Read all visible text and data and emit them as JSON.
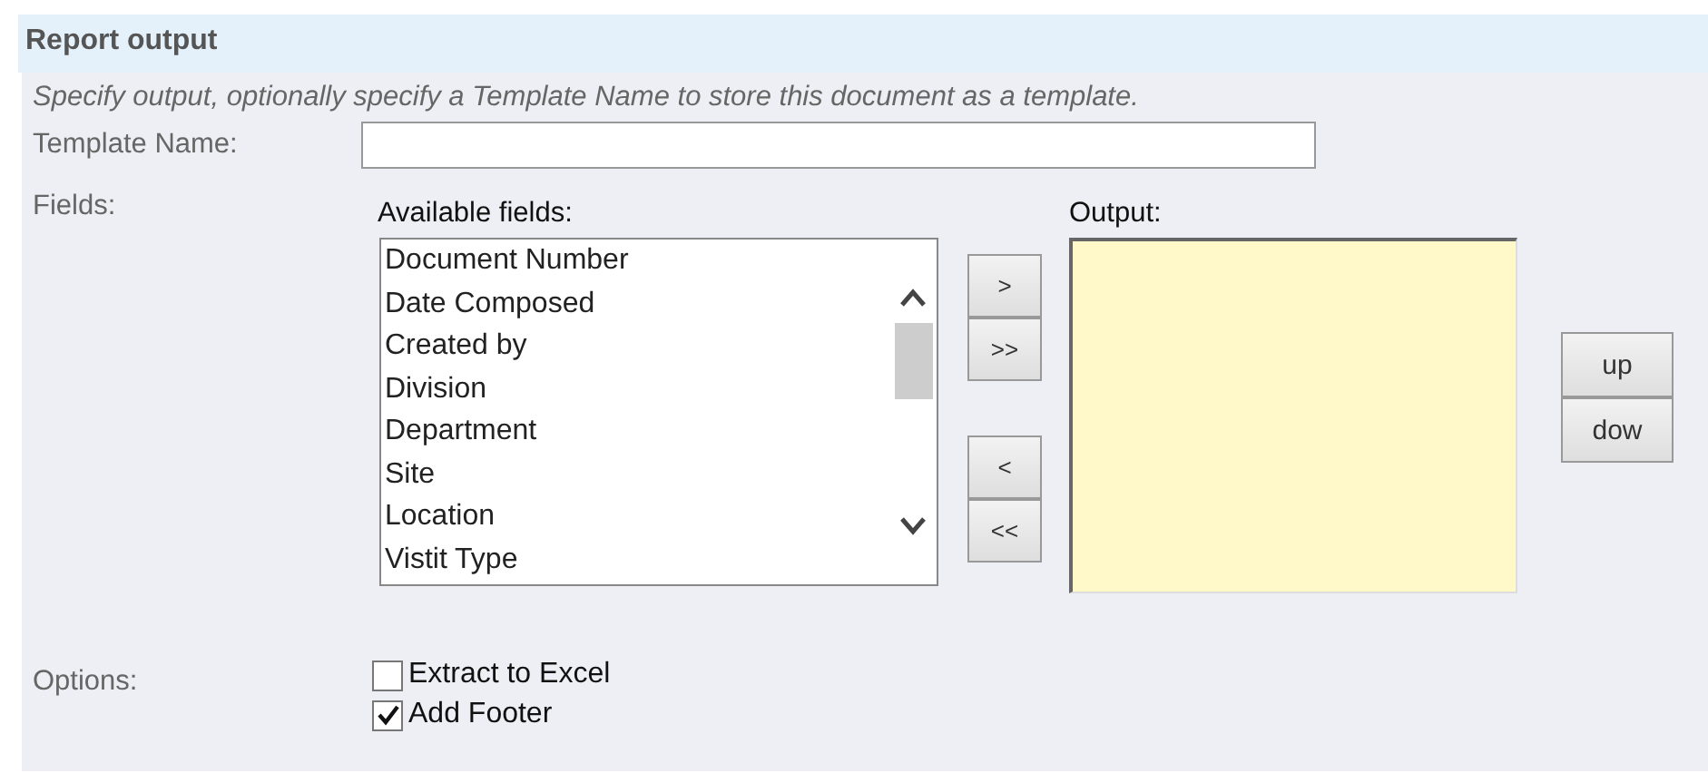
{
  "section": {
    "title": "Report output",
    "description": "Specify output, optionally specify a Template Name to store this document as a template."
  },
  "template_name": {
    "label": "Template Name:"
  },
  "fields": {
    "label": "Fields:",
    "available_label": "Available fields:",
    "available": [
      "Document Number",
      "Date Composed",
      "Created by",
      "Division",
      "Department",
      "Site",
      "Location",
      "Vistit Type"
    ],
    "move_buttons": [
      {
        "label": ">"
      },
      {
        "label": ">>"
      },
      {
        "label": "<"
      },
      {
        "label": "<<"
      }
    ],
    "output_label": "Output:",
    "order_buttons": [
      {
        "label": "up"
      },
      {
        "label": "dow"
      }
    ]
  },
  "options": {
    "label": "Options:",
    "items": [
      {
        "label": "Extract to Excel",
        "checked": false
      },
      {
        "label": "Add Footer",
        "checked": true
      }
    ]
  }
}
